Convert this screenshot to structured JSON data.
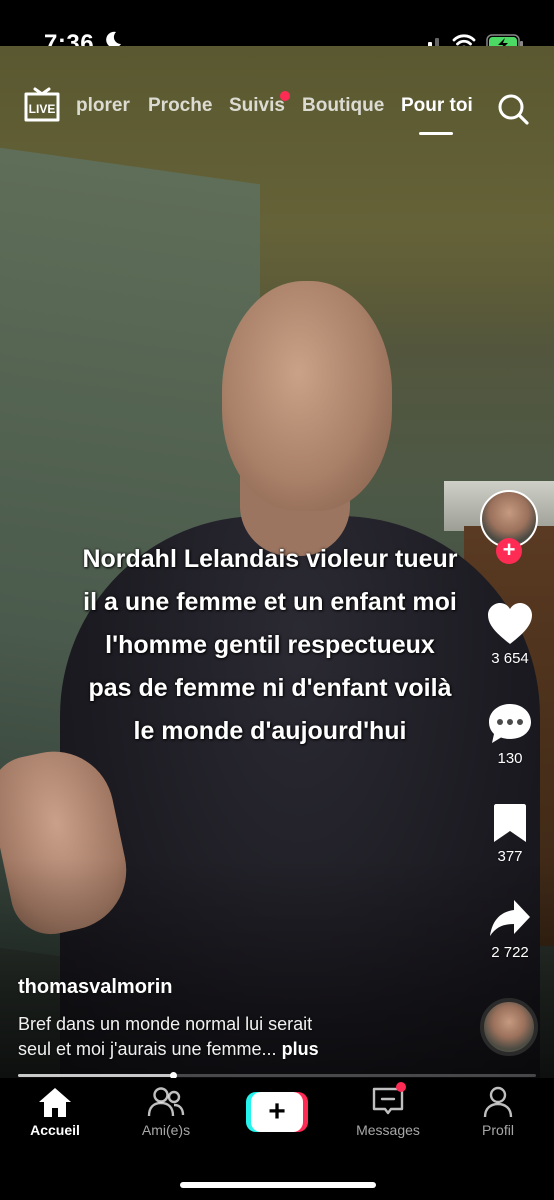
{
  "status_bar": {
    "time": "7:36",
    "moon_icon": "moon-icon",
    "signal_icon": "cellular-signal-icon",
    "wifi_icon": "wifi-icon",
    "battery_icon": "battery-charging-icon",
    "battery_color": "#4cd964"
  },
  "top_nav": {
    "live_label": "LIVE",
    "tabs": [
      {
        "label": "plorer",
        "active": false
      },
      {
        "label": "Proche",
        "active": false
      },
      {
        "label": "Suivis",
        "active": false,
        "notification_dot": true
      },
      {
        "label": "Boutique",
        "active": false
      },
      {
        "label": "Pour toi",
        "active": true
      }
    ],
    "search_icon": "search-icon"
  },
  "video": {
    "caption_lines": [
      "Nordahl Lelandais violeur tueur",
      "il a une femme et un enfant moi",
      "l'homme gentil respectueux",
      "pas de femme ni d'enfant voilà",
      "le monde d'aujourd'hui"
    ],
    "progress": 0.3
  },
  "actions": {
    "follow_icon": "plus-icon",
    "like_count": "3 654",
    "comment_count": "130",
    "save_count": "377",
    "share_count": "2 722"
  },
  "post": {
    "username": "thomasvalmorin",
    "description_line1": "Bref dans un monde normal lui serait",
    "description_line2": "seul et moi j'aurais une femme...",
    "more_label": "plus"
  },
  "tab_bar": {
    "home_label": "Accueil",
    "friends_label": "Ami(e)s",
    "create_label": "+",
    "messages_label": "Messages",
    "profile_label": "Profil"
  },
  "colors": {
    "accent_red": "#fe2c55",
    "accent_cyan": "#25f4ee"
  }
}
